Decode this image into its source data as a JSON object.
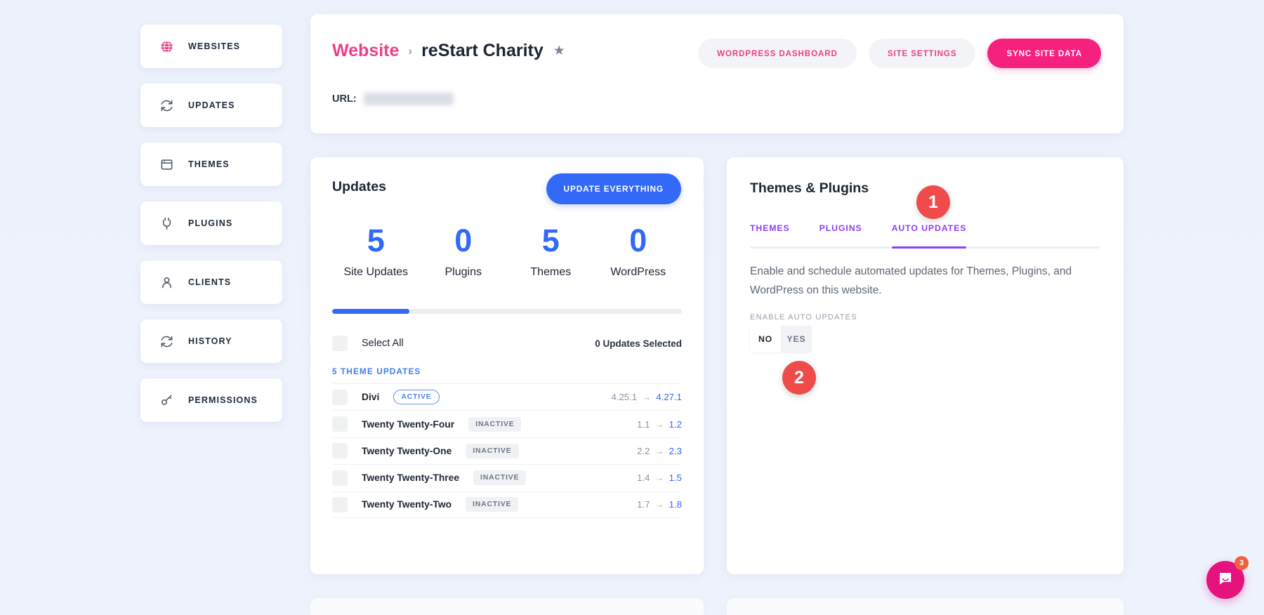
{
  "sidebar": {
    "items": [
      {
        "label": "WEBSITES",
        "icon": "globe-icon",
        "active": true
      },
      {
        "label": "UPDATES",
        "icon": "refresh-icon",
        "active": false
      },
      {
        "label": "THEMES",
        "icon": "window-icon",
        "active": false
      },
      {
        "label": "PLUGINS",
        "icon": "plug-icon",
        "active": false
      },
      {
        "label": "CLIENTS",
        "icon": "user-icon",
        "active": false
      },
      {
        "label": "HISTORY",
        "icon": "refresh-icon",
        "active": false
      },
      {
        "label": "PERMISSIONS",
        "icon": "key-icon",
        "active": false
      }
    ]
  },
  "header": {
    "breadcrumb_root": "Website",
    "breadcrumb_separator": "›",
    "breadcrumb_current": "reStart Charity",
    "favorite_icon": "star-icon",
    "url_label": "URL:",
    "url_value": "",
    "buttons": {
      "wordpress_dashboard": "WORDPRESS DASHBOARD",
      "site_settings": "SITE SETTINGS",
      "sync_site_data": "SYNC SITE DATA"
    }
  },
  "updates": {
    "title": "Updates",
    "update_everything_label": "UPDATE EVERYTHING",
    "stats": [
      {
        "value": "5",
        "label": "Site Updates"
      },
      {
        "value": "0",
        "label": "Plugins"
      },
      {
        "value": "5",
        "label": "Themes"
      },
      {
        "value": "0",
        "label": "WordPress"
      }
    ],
    "progress_percent": 22,
    "select_all_label": "Select All",
    "selected_count_label": "0 Updates Selected",
    "section_label": "5 THEME UPDATES",
    "rows": [
      {
        "name": "Divi",
        "status": "ACTIVE",
        "status_kind": "active",
        "old": "4.25.1",
        "new": "4.27.1"
      },
      {
        "name": "Twenty Twenty-Four",
        "status": "INACTIVE",
        "status_kind": "inactive",
        "old": "1.1",
        "new": "1.2"
      },
      {
        "name": "Twenty Twenty-One",
        "status": "INACTIVE",
        "status_kind": "inactive",
        "old": "2.2",
        "new": "2.3"
      },
      {
        "name": "Twenty Twenty-Three",
        "status": "INACTIVE",
        "status_kind": "inactive",
        "old": "1.4",
        "new": "1.5"
      },
      {
        "name": "Twenty Twenty-Two",
        "status": "INACTIVE",
        "status_kind": "inactive",
        "old": "1.7",
        "new": "1.8"
      }
    ],
    "version_arrow": "→"
  },
  "themes_plugins": {
    "title": "Themes & Plugins",
    "tabs": [
      {
        "label": "THEMES",
        "active": false
      },
      {
        "label": "PLUGINS",
        "active": false
      },
      {
        "label": "AUTO UPDATES",
        "active": true
      }
    ],
    "description": "Enable and schedule automated updates for Themes, Plugins, and WordPress on this website.",
    "enable_label": "ENABLE AUTO UPDATES",
    "toggle": {
      "no_label": "NO",
      "yes_label": "YES",
      "selected": "NO"
    }
  },
  "callouts": [
    {
      "id": "1",
      "number": "1"
    },
    {
      "id": "2",
      "number": "2"
    }
  ],
  "support": {
    "icon": "chat-icon",
    "unread_count": "3"
  },
  "colors": {
    "brand_pink": "#f6207f",
    "link_pink": "#ec3f8a",
    "accent_blue": "#3269f6",
    "tab_purple": "#8a3ff0",
    "callout_red": "#ef4b4b",
    "page_bg": "#eef2fb"
  }
}
